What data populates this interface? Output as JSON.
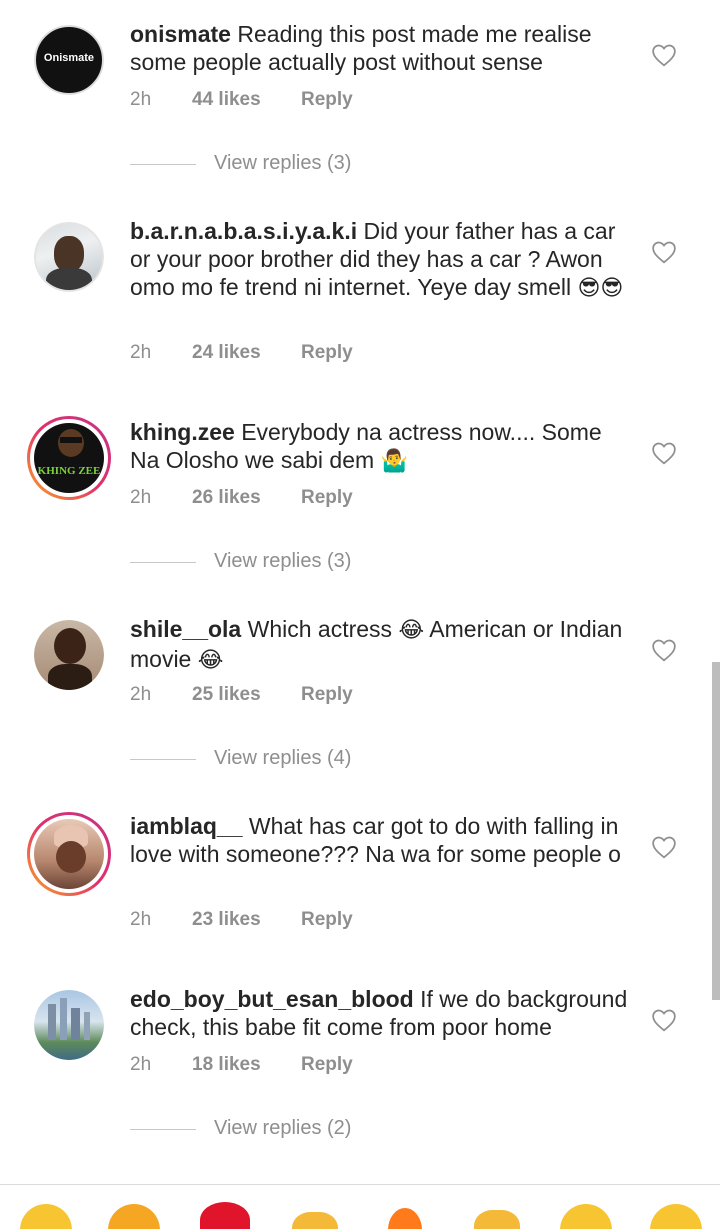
{
  "comments": [
    {
      "username": "onismate",
      "text": "Reading this post made me realise some people actually post without sense",
      "time": "2h",
      "likes": "44 likes",
      "reply": "Reply",
      "avatar_text": "Onismate",
      "replies": "View replies (3)"
    },
    {
      "username": "b.a.r.n.a.b.a.s.i.y.a.k.i",
      "text": "Did your father has a car or your poor brother did they has a car ? Awon omo mo fe trend ni internet. Yeye day smell",
      "emoji": "😎😎",
      "time": "2h",
      "likes": "24 likes",
      "reply": "Reply"
    },
    {
      "username": "khing.zee",
      "text": "Everybody na actress now.... Some Na Olosho we sabi dem",
      "emoji": "🤷‍♂️",
      "time": "2h",
      "likes": "26 likes",
      "reply": "Reply",
      "avatar_text": "KHING ZEE",
      "replies": "View replies (3)"
    },
    {
      "username": "shile__ola",
      "text": "Which actress",
      "emoji": "😂",
      "text2": "American or Indian movie",
      "emoji2": "😂",
      "time": "2h",
      "likes": "25 likes",
      "reply": "Reply",
      "replies": "View replies (4)"
    },
    {
      "username": "iamblaq__",
      "text": "What has car got to do with falling in love with someone??? Na wa for some people o",
      "time": "2h",
      "likes": "23 likes",
      "reply": "Reply"
    },
    {
      "username": "edo_boy_but_esan_blood",
      "text": "If we do background check, this babe fit come from poor home",
      "time": "2h",
      "likes": "18 likes",
      "reply": "Reply",
      "replies": "View replies (2)"
    }
  ],
  "colors": {
    "text": "#262626",
    "muted": "#8e8e8e",
    "story_ring_start": "#f9a825",
    "story_ring_end": "#c13584"
  },
  "icons": {
    "like": "heart-outline-icon"
  }
}
